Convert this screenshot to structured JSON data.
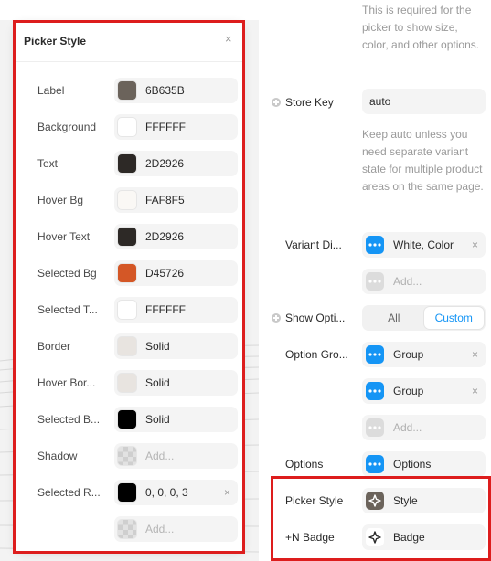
{
  "picker_style_popover": {
    "title": "Picker Style",
    "close_icon": "×",
    "rows": [
      {
        "label": "Label",
        "swatch": "#6B635B",
        "value": "6B635B"
      },
      {
        "label": "Background",
        "swatch": "#FFFFFF",
        "value": "FFFFFF"
      },
      {
        "label": "Text",
        "swatch": "#2D2926",
        "value": "2D2926"
      },
      {
        "label": "Hover Bg",
        "swatch": "#FAF8F5",
        "value": "FAF8F5"
      },
      {
        "label": "Hover Text",
        "swatch": "#2D2926",
        "value": "2D2926"
      },
      {
        "label": "Selected Bg",
        "swatch": "#D45726",
        "value": "D45726"
      },
      {
        "label": "Selected T...",
        "swatch": "#FFFFFF",
        "value": "FFFFFF"
      },
      {
        "label": "Border",
        "swatch": "#E8E4E0",
        "value": "Solid"
      },
      {
        "label": "Hover Bor...",
        "swatch": "#E8E4E0",
        "value": "Solid"
      },
      {
        "label": "Selected B...",
        "swatch": "#000000",
        "value": "Solid"
      },
      {
        "label": "Shadow",
        "swatch": "checker",
        "value": "Add...",
        "placeholder": true
      },
      {
        "label": "Selected R...",
        "swatch": "#000000",
        "value": "0, 0, 0, 3",
        "removable": true
      },
      {
        "label": "",
        "swatch": "checker",
        "value": "Add...",
        "placeholder": true
      }
    ]
  },
  "inspector": {
    "top_help": "This is required for the picker to show size, color, and other options.",
    "store_key": {
      "label": "Store Key",
      "value": "auto"
    },
    "store_key_help": "Keep auto unless you need separate variant state for multiple product areas on the same page.",
    "variant_display": {
      "label": "Variant Di...",
      "chip": "White, Color",
      "add": "Add..."
    },
    "show_options": {
      "label": "Show Opti...",
      "options": [
        "All",
        "Custom"
      ],
      "selected": "Custom"
    },
    "option_groups": {
      "label": "Option Gro...",
      "chips": [
        "Group",
        "Group"
      ],
      "add": "Add..."
    },
    "options": {
      "label": "Options",
      "chip": "Options"
    },
    "picker_style": {
      "label": "Picker Style",
      "chip": "Style"
    },
    "n_badge": {
      "label": "+N Badge",
      "chip": "Badge"
    },
    "remove_icon": "×"
  },
  "icons": {
    "component": "dots-icon",
    "style": "sparkle-icon",
    "add": "plus-circle-icon"
  },
  "colors": {
    "accent": "#1595F5",
    "highlight": "#DD1D1D"
  }
}
